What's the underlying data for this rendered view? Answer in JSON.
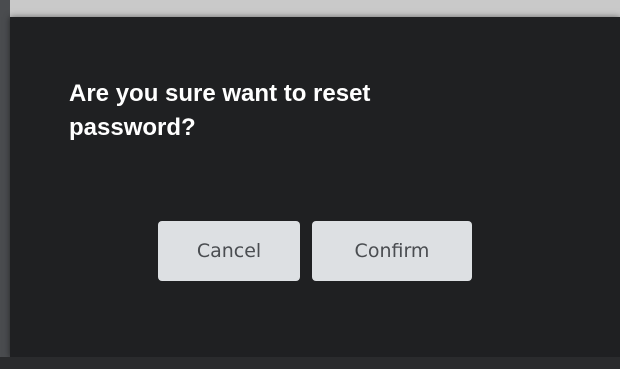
{
  "dialog": {
    "title": "Are you sure want to reset password?",
    "cancel_label": "Cancel",
    "confirm_label": "Confirm"
  }
}
